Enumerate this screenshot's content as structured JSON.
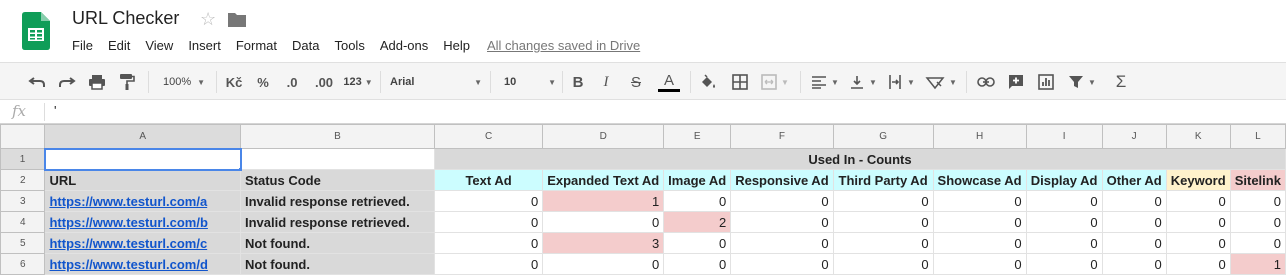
{
  "app": {
    "title": "URL Checker",
    "save_status": "All changes saved in Drive"
  },
  "menu": [
    "File",
    "Edit",
    "View",
    "Insert",
    "Format",
    "Data",
    "Tools",
    "Add-ons",
    "Help"
  ],
  "toolbar": {
    "zoom": "100%",
    "currency": "Kč",
    "percent": "%",
    "decrease_decimals": ".0",
    "increase_decimals": ".00",
    "more_formats": "123",
    "font": "Arial",
    "font_size": "10",
    "bold": "B",
    "italic": "I",
    "strike": "S",
    "text_color": "A",
    "sigma": "Σ"
  },
  "formula_bar": {
    "fx": "fx",
    "value": "'"
  },
  "columns": [
    "A",
    "B",
    "C",
    "D",
    "E",
    "F",
    "G",
    "H",
    "I",
    "J",
    "K",
    "L"
  ],
  "sheet": {
    "row1_merged": "Used In - Counts",
    "header": {
      "url": "URL",
      "status": "Status Code",
      "text_ad": "Text Ad",
      "expanded_text_ad": "Expanded Text Ad",
      "image_ad": "Image Ad",
      "responsive_ad": "Responsive Ad",
      "third_party_ad": "Third Party Ad",
      "showcase_ad": "Showcase Ad",
      "display_ad": "Display Ad",
      "other_ad": "Other Ad",
      "keyword": "Keyword",
      "sitelink": "Sitelink"
    },
    "rows": [
      {
        "num": "3",
        "url": "https://www.testurl.com/a",
        "status": "Invalid response retrieved.",
        "c": "0",
        "d": "1",
        "e": "0",
        "f": "0",
        "g": "0",
        "h": "0",
        "i": "0",
        "j": "0",
        "k": "0",
        "l": "0"
      },
      {
        "num": "4",
        "url": "https://www.testurl.com/b",
        "status": "Invalid response retrieved.",
        "c": "0",
        "d": "0",
        "e": "2",
        "f": "0",
        "g": "0",
        "h": "0",
        "i": "0",
        "j": "0",
        "k": "0",
        "l": "0"
      },
      {
        "num": "5",
        "url": "https://www.testurl.com/c",
        "status": "Not found.",
        "c": "0",
        "d": "3",
        "e": "0",
        "f": "0",
        "g": "0",
        "h": "0",
        "i": "0",
        "j": "0",
        "k": "0",
        "l": "0"
      },
      {
        "num": "6",
        "url": "https://www.testurl.com/d",
        "status": "Not found.",
        "c": "0",
        "d": "0",
        "e": "0",
        "f": "0",
        "g": "0",
        "h": "0",
        "i": "0",
        "j": "0",
        "k": "0",
        "l": "1"
      }
    ],
    "row_numbers": [
      "1",
      "2"
    ]
  },
  "colors": {
    "sheets_green": "#0f9d58",
    "cyan_header": "#ccfdff",
    "yellow_header": "#fff2cc",
    "red_highlight": "#f4cccc",
    "gray_fill": "#d9d9d9",
    "selection_blue": "#4a86e8",
    "link_blue": "#1155cc"
  },
  "icons": [
    "sheets-logo-icon",
    "star-icon",
    "folder-icon",
    "undo-icon",
    "redo-icon",
    "print-icon",
    "paint-format-icon",
    "fill-color-icon",
    "borders-icon",
    "merge-cells-icon",
    "align-left-icon",
    "valign-bottom-icon",
    "text-wrap-icon",
    "text-rotate-icon",
    "link-icon",
    "comment-icon",
    "chart-icon",
    "filter-icon",
    "functions-icon"
  ]
}
